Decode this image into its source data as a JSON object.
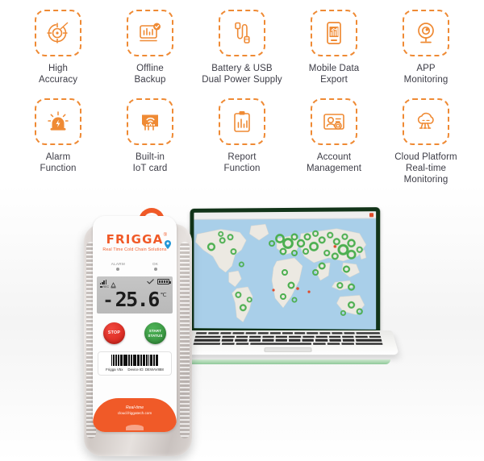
{
  "features": {
    "row1": [
      {
        "icon": "target-accuracy-icon",
        "label": "High\nAccuracy"
      },
      {
        "icon": "offline-backup-chart-icon",
        "label": "Offline\nBackup"
      },
      {
        "icon": "battery-usb-cable-icon",
        "label": "Battery & USB\nDual Power Supply"
      },
      {
        "icon": "mobile-data-export-icon",
        "label": "Mobile Data\nExport"
      },
      {
        "icon": "app-monitoring-webcam-icon",
        "label": "APP\nMonitoring"
      }
    ],
    "row2": [
      {
        "icon": "alarm-siren-icon",
        "label": "Alarm\nFunction"
      },
      {
        "icon": "iot-card-wifi-icon",
        "label": "Built-in\nIoT card"
      },
      {
        "icon": "report-clipboard-icon",
        "label": "Report\nFunction"
      },
      {
        "icon": "account-management-icon",
        "label": "Account\nManagement"
      },
      {
        "icon": "cloud-platform-icon",
        "label": "Cloud Platform\nReal-time\nMonitoring"
      }
    ]
  },
  "device": {
    "brand_name": "FRIGGA",
    "brand_registered": "®",
    "tagline": "Real Time Cold Chain Solutions",
    "gps_icon": "location-pin-icon",
    "leds": [
      {
        "label": "ALARM",
        "name": "alarm-led"
      },
      {
        "label": "OK",
        "name": "ok-led"
      }
    ],
    "lcd": {
      "signal_icon": "signal-bars-icon",
      "satellite_icon": "satellite-icon",
      "rec_label": "REC",
      "check_icon": "check-icon",
      "battery_icon": "battery-full-icon",
      "minus": "-",
      "value": "25.6",
      "unit": "℃"
    },
    "buttons": [
      {
        "label": "STOP",
        "name": "stop-button",
        "color": "#d31f16"
      },
      {
        "label": "START\nSTATUS",
        "name": "start-status-button",
        "color": "#2f8a37"
      }
    ],
    "plate": {
      "barcode_icon": "barcode",
      "model": "Frigga V5x",
      "device_id": "Device ID: DEWAV888"
    },
    "strip": {
      "line1": "Real-time",
      "line2": "cloud.friggatech.com"
    }
  },
  "laptop": {
    "screen": {
      "app": "world-map-monitoring",
      "browser_close_icon": "close-icon",
      "marker_color": "#4caf50",
      "alert_marker_color": "#e04b2a",
      "ocean_color": "#a9cfe9",
      "land_color": "#ece9e2"
    },
    "lid_color": "#113318",
    "base_color": "#8fc99a"
  },
  "colors": {
    "accent_orange": "#ef8a34",
    "brand_orange": "#f05a28",
    "text_dark": "#3c3c46"
  }
}
